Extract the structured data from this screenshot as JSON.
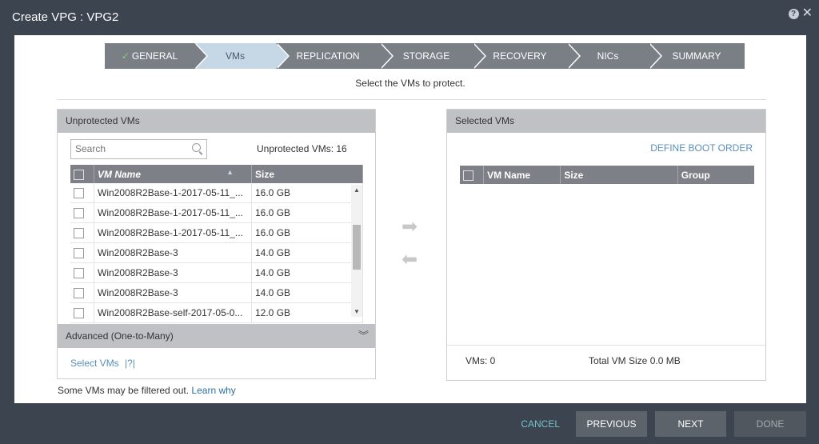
{
  "window": {
    "title": "Create VPG : VPG2"
  },
  "wizard": {
    "steps": [
      {
        "label": "GENERAL",
        "state": "done"
      },
      {
        "label": "VMs",
        "state": "active"
      },
      {
        "label": "REPLICATION",
        "state": "pending"
      },
      {
        "label": "STORAGE",
        "state": "pending"
      },
      {
        "label": "RECOVERY",
        "state": "pending"
      },
      {
        "label": "NICs",
        "state": "pending"
      },
      {
        "label": "SUMMARY",
        "state": "pending"
      }
    ],
    "instruction": "Select the VMs to protect."
  },
  "unprotected": {
    "title": "Unprotected VMs",
    "search_placeholder": "Search",
    "count_label": "Unprotected VMs: 16",
    "headers": {
      "name": "VM Name",
      "size": "Size"
    },
    "rows": [
      {
        "name": "Win2008R2Base-1-2017-05-11_...",
        "size": "16.0 GB"
      },
      {
        "name": "Win2008R2Base-1-2017-05-11_...",
        "size": "16.0 GB"
      },
      {
        "name": "Win2008R2Base-1-2017-05-11_...",
        "size": "16.0 GB"
      },
      {
        "name": "Win2008R2Base-3",
        "size": "14.0 GB"
      },
      {
        "name": "Win2008R2Base-3",
        "size": "14.0 GB"
      },
      {
        "name": "Win2008R2Base-3",
        "size": "14.0 GB"
      },
      {
        "name": "Win2008R2Base-self-2017-05-0...",
        "size": "12.0 GB"
      }
    ],
    "advanced_label": "Advanced (One-to-Many)",
    "select_vms": "Select VMs",
    "help_marker": "|?|"
  },
  "filter_note": {
    "text": "Some VMs may be filtered out.",
    "link": "Learn why"
  },
  "selected": {
    "title": "Selected VMs",
    "boot_order": "DEFINE BOOT ORDER",
    "headers": {
      "name": "VM Name",
      "size": "Size",
      "group": "Group"
    },
    "vms_count": "VMs: 0",
    "total_size": "Total VM Size 0.0 MB"
  },
  "footer": {
    "cancel": "CANCEL",
    "previous": "PREVIOUS",
    "next": "NEXT",
    "done": "DONE"
  }
}
